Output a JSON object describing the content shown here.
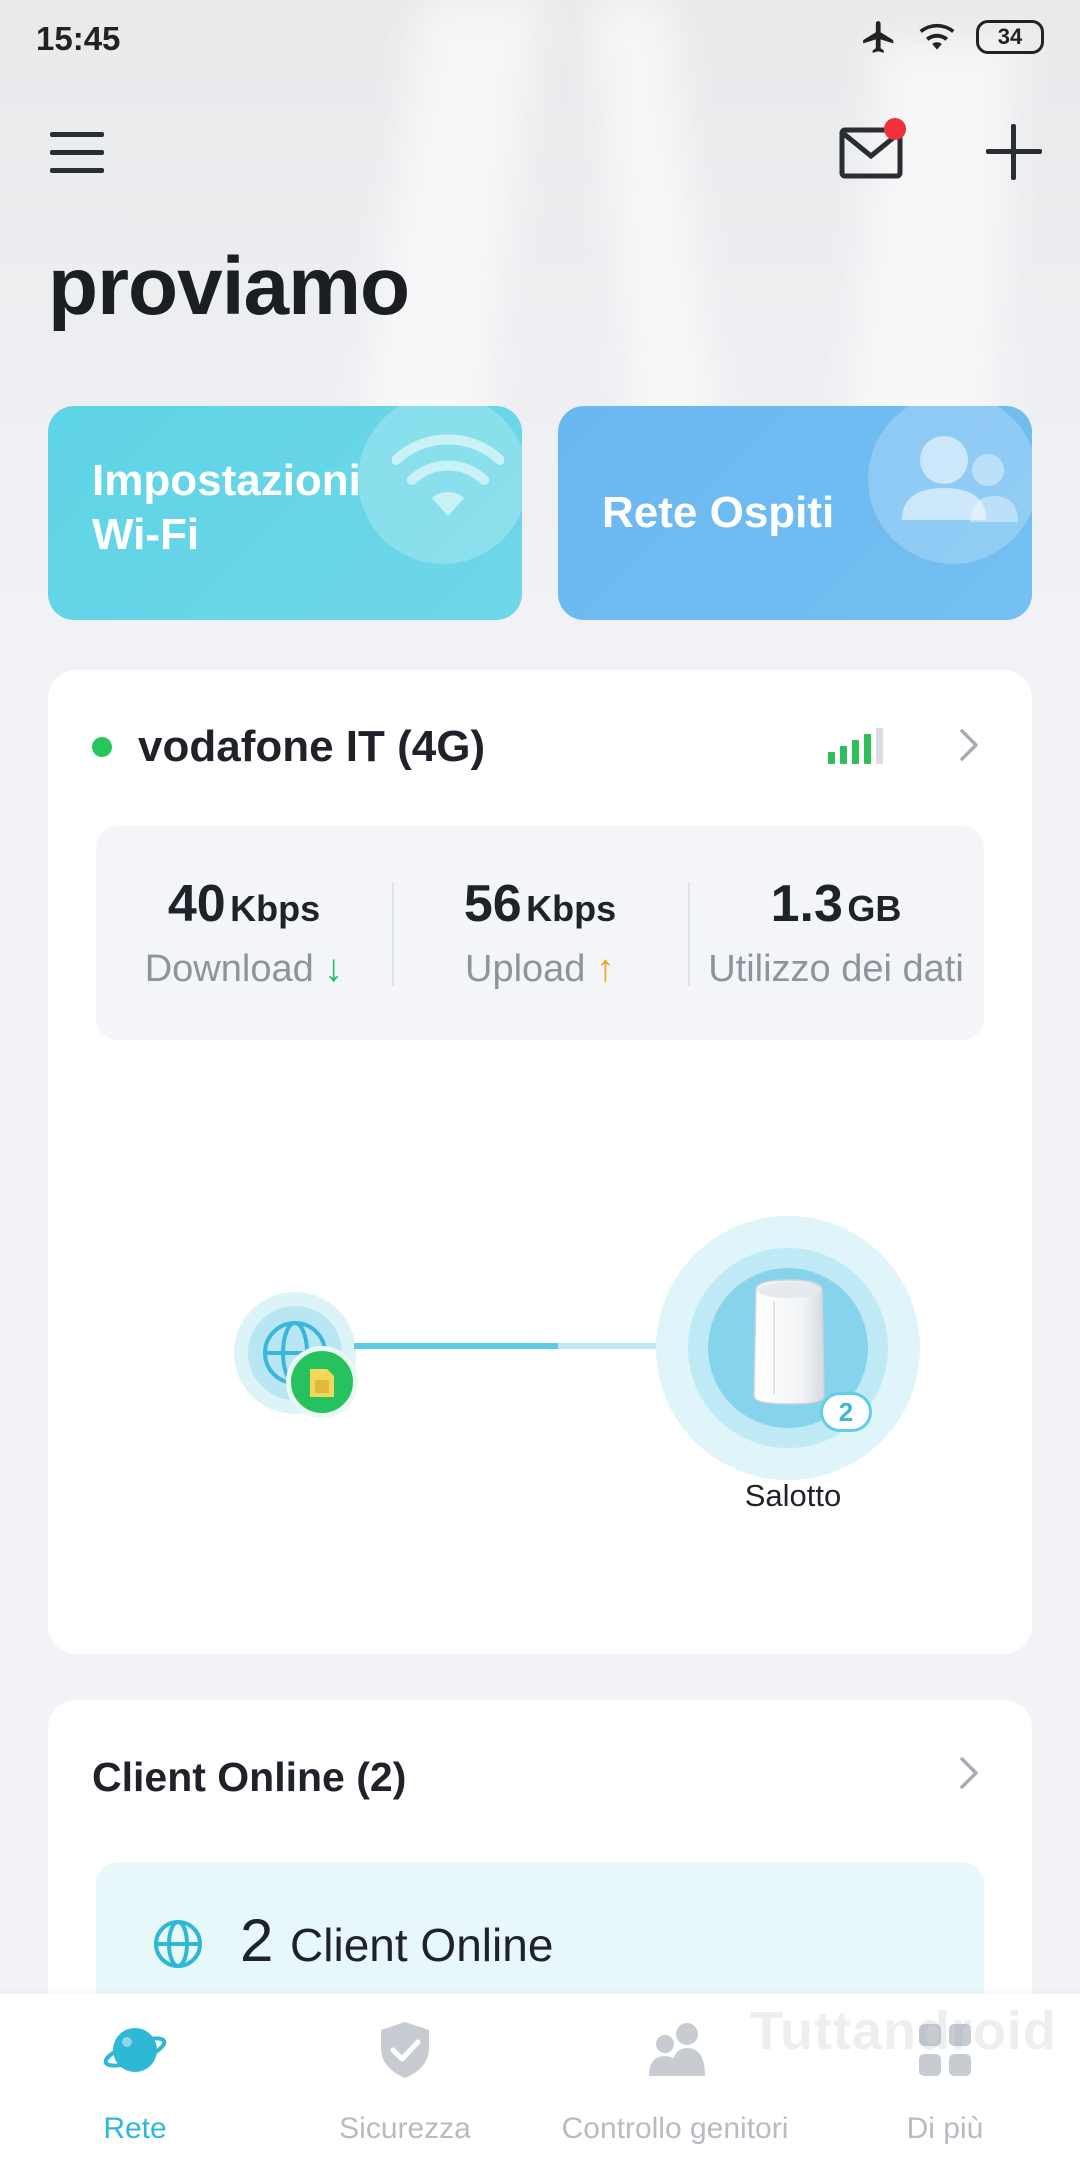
{
  "status_bar": {
    "time": "15:45",
    "battery": "34"
  },
  "header": {
    "title": "proviamo"
  },
  "tiles": {
    "wifi": {
      "line1": "Impostazioni",
      "line2": "Wi-Fi"
    },
    "guest": {
      "label": "Rete Ospiti"
    }
  },
  "network": {
    "name": "vodafone IT (4G)",
    "status": "online",
    "signal_bars": 4,
    "stats": [
      {
        "value": "40",
        "unit": "Kbps",
        "label": "Download",
        "arrow": "↓"
      },
      {
        "value": "56",
        "unit": "Kbps",
        "label": "Upload",
        "arrow": "↑"
      },
      {
        "value": "1.3",
        "unit": "GB",
        "label": "Utilizzo dei dati"
      }
    ],
    "router": {
      "name": "Salotto",
      "clients": "2"
    }
  },
  "clients": {
    "title": "Client Online (2)",
    "count": "2",
    "count_label": "Client Online"
  },
  "nav": {
    "items": [
      {
        "label": "Rete",
        "icon": "planet-icon",
        "active": true
      },
      {
        "label": "Sicurezza",
        "icon": "shield-icon",
        "active": false
      },
      {
        "label": "Controllo genitori",
        "icon": "family-icon",
        "active": false
      },
      {
        "label": "Di più",
        "icon": "grid-icon",
        "active": false
      }
    ]
  },
  "watermark": "Tuttandroid",
  "colors": {
    "accent": "#2fb8d6",
    "wifi_tile": "#5ed4e6",
    "guest_tile": "#6ab8f0",
    "online": "#26c65a",
    "download": "#27c260",
    "upload": "#f2a51e"
  }
}
